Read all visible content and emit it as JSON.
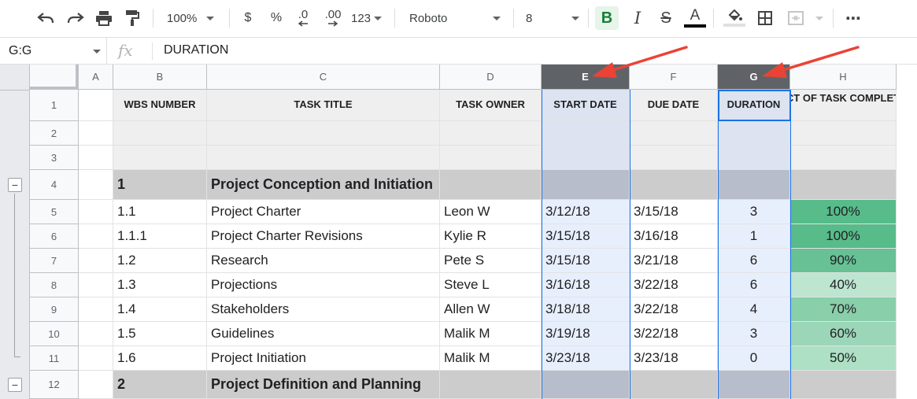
{
  "toolbar": {
    "zoom": "100%",
    "currency": "$",
    "percent": "%",
    "decrease_decimal": ".0",
    "increase_decimal": ".00",
    "number_format": "123",
    "font_family": "Roboto",
    "font_size": "8",
    "bold_glyph": "B",
    "italic_glyph": "I",
    "strike_glyph": "S",
    "text_color_glyph": "A",
    "more": "⋯",
    "icons": [
      "undo-icon",
      "redo-icon",
      "print-icon",
      "paint-format-icon",
      "fill-color-icon",
      "borders-icon",
      "merge-cells-icon"
    ]
  },
  "formula_bar": {
    "name_box": "G:G",
    "fx_label": "fx",
    "value": "DURATION"
  },
  "columns": [
    {
      "letter": "A",
      "selected": false
    },
    {
      "letter": "B",
      "selected": false
    },
    {
      "letter": "C",
      "selected": false
    },
    {
      "letter": "D",
      "selected": false
    },
    {
      "letter": "E",
      "selected": true
    },
    {
      "letter": "F",
      "selected": false
    },
    {
      "letter": "G",
      "selected": true
    },
    {
      "letter": "H",
      "selected": false
    }
  ],
  "row_numbers": [
    "1",
    "2",
    "3",
    "4",
    "5",
    "6",
    "7",
    "8",
    "9",
    "10",
    "11",
    "12"
  ],
  "group_toggle_glyph": "−",
  "headers": {
    "wbs": "WBS NUMBER",
    "task": "TASK TITLE",
    "owner": "TASK OWNER",
    "start": "START DATE",
    "due": "DUE DATE",
    "duration": "DURATION",
    "pct": "PCT OF TASK COMPLETE"
  },
  "groups": [
    {
      "wbs": "1",
      "title": "Project Conception and Initiation"
    },
    {
      "wbs": "2",
      "title": "Project Definition and Planning"
    }
  ],
  "tasks": [
    {
      "wbs": "1.1",
      "title": "Project Charter",
      "owner": "Leon W",
      "start": "3/12/18",
      "due": "3/15/18",
      "duration": "3",
      "pct": "100%",
      "pct_color": "#57bb8a"
    },
    {
      "wbs": "1.1.1",
      "title": "Project Charter Revisions",
      "owner": "Kylie R",
      "start": "3/15/18",
      "due": "3/16/18",
      "duration": "1",
      "pct": "100%",
      "pct_color": "#57bb8a"
    },
    {
      "wbs": "1.2",
      "title": "Research",
      "owner": "Pete S",
      "start": "3/15/18",
      "due": "3/21/18",
      "duration": "6",
      "pct": "90%",
      "pct_color": "#67c194"
    },
    {
      "wbs": "1.3",
      "title": "Projections",
      "owner": "Steve L",
      "start": "3/16/18",
      "due": "3/22/18",
      "duration": "6",
      "pct": "40%",
      "pct_color": "#bde5d0"
    },
    {
      "wbs": "1.4",
      "title": "Stakeholders",
      "owner": "Allen W",
      "start": "3/18/18",
      "due": "3/22/18",
      "duration": "4",
      "pct": "70%",
      "pct_color": "#89cfaa"
    },
    {
      "wbs": "1.5",
      "title": "Guidelines",
      "owner": "Malik M",
      "start": "3/19/18",
      "due": "3/22/18",
      "duration": "3",
      "pct": "60%",
      "pct_color": "#9cd6b8"
    },
    {
      "wbs": "1.6",
      "title": "Project Initiation",
      "owner": "Malik M",
      "start": "3/23/18",
      "due": "3/23/18",
      "duration": "0",
      "pct": "50%",
      "pct_color": "#ade0c4"
    }
  ],
  "colors": {
    "selected_header": "#5f6368",
    "selection_blue": "#1a73e8",
    "selection_tint": "#e8effc",
    "group_row": "#cccccc",
    "header_row": "#efefef",
    "annotation_arrow": "#ea4335"
  }
}
